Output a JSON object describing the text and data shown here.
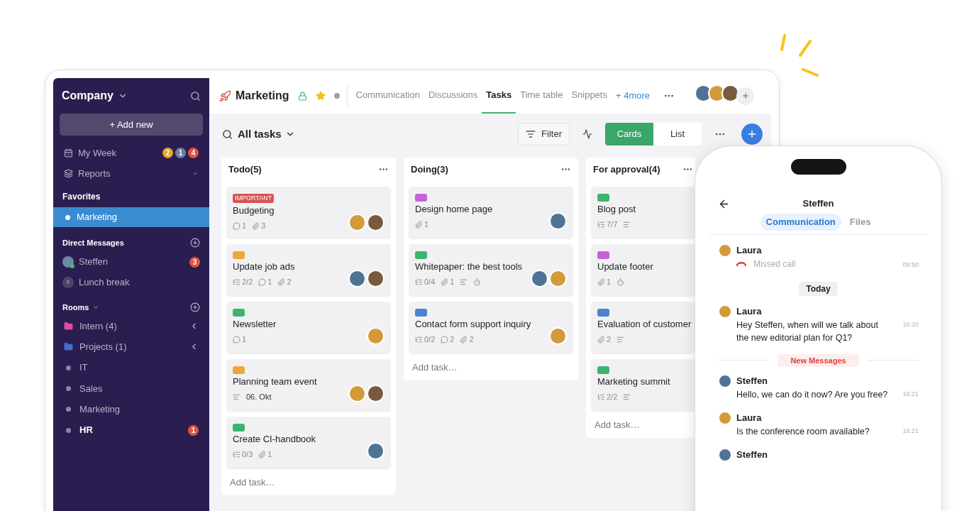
{
  "sidebar": {
    "title": "Company",
    "add_button": "+ Add new",
    "nav": [
      {
        "kind": "week",
        "label": "My Week",
        "badges": [
          {
            "text": "2",
            "color": "#e5a823"
          },
          {
            "text": "1",
            "color": "#6b7fa6"
          },
          {
            "text": "4",
            "color": "#e0533d"
          }
        ]
      },
      {
        "kind": "reports",
        "label": "Reports"
      }
    ],
    "favorites": {
      "heading": "Favorites",
      "items": [
        {
          "label": "Marketing",
          "selected": true
        }
      ]
    },
    "direct_messages": {
      "heading": "Direct Messages",
      "items": [
        {
          "kind": "person",
          "label": "Steffen",
          "online": true,
          "badge": "3"
        },
        {
          "kind": "group",
          "label": "Lunch break",
          "initial": "5"
        }
      ]
    },
    "rooms": {
      "heading": "Rooms",
      "items": [
        {
          "kind": "folder",
          "label": "Intern (4)",
          "color": "#e04fa0",
          "unread": false
        },
        {
          "kind": "folder",
          "label": "Projects (1)",
          "color": "#3f6fd0",
          "unread": false
        },
        {
          "kind": "room",
          "label": "IT",
          "unread": false
        },
        {
          "kind": "room",
          "label": "Sales",
          "unread": false
        },
        {
          "kind": "room",
          "label": "Marketing",
          "unread": false
        },
        {
          "kind": "room",
          "label": "HR",
          "unread": true,
          "badge": "1"
        }
      ]
    }
  },
  "header": {
    "title": "Marketing",
    "tabs": [
      {
        "label": "Communication",
        "selected": false
      },
      {
        "label": "Discussions",
        "selected": false
      },
      {
        "label": "Tasks",
        "selected": true
      },
      {
        "label": "Time table",
        "selected": false
      },
      {
        "label": "Snippets",
        "selected": false
      }
    ],
    "more_link": "+ 4more",
    "members": [
      {
        "color": "#4f7396"
      },
      {
        "color": "#d39a3a"
      },
      {
        "color": "#7a5a3c"
      }
    ]
  },
  "toolbar": {
    "view_title": "All tasks",
    "filter": "Filter",
    "views": [
      {
        "label": "Cards",
        "selected": true
      },
      {
        "label": "List",
        "selected": false
      }
    ]
  },
  "columns": [
    {
      "title": "Todo(5)",
      "add_task": "Add task…",
      "cards": [
        {
          "tag": {
            "kind": "badge",
            "text": "IMPORTANT"
          },
          "title": "Budgeting",
          "meta": [
            {
              "kind": "comments",
              "text": "1"
            },
            {
              "kind": "attachments",
              "text": "3"
            }
          ],
          "avatars": [
            {
              "color": "#d39a3a"
            },
            {
              "color": "#7a5a3c"
            }
          ]
        },
        {
          "tag": {
            "kind": "color",
            "color": "#eaa73c"
          },
          "title": "Update job ads",
          "meta": [
            {
              "kind": "subtasks",
              "text": "2/2"
            },
            {
              "kind": "comments",
              "text": "1"
            },
            {
              "kind": "attachments",
              "text": "2"
            }
          ],
          "avatars": [
            {
              "color": "#4f7396"
            },
            {
              "color": "#7a5a3c"
            }
          ]
        },
        {
          "tag": {
            "kind": "color",
            "color": "#3cb46e"
          },
          "title": "Newsletter",
          "meta": [
            {
              "kind": "comments",
              "text": "1"
            }
          ],
          "avatars": [
            {
              "color": "#d39a3a"
            }
          ]
        },
        {
          "tag": {
            "kind": "color",
            "color": "#eaa73c"
          },
          "title": "Planning team event",
          "meta": [
            {
              "kind": "notes",
              "text": "06. Okt"
            }
          ],
          "avatars": [
            {
              "color": "#d39a3a"
            },
            {
              "color": "#7a5a3c"
            }
          ]
        },
        {
          "tag": {
            "kind": "color",
            "color": "#3cb46e"
          },
          "title": "Create CI-handbook",
          "meta": [
            {
              "kind": "subtasks",
              "text": "0/3"
            },
            {
              "kind": "attachments",
              "text": "1"
            }
          ],
          "avatars": [
            {
              "color": "#4f7396"
            }
          ]
        }
      ]
    },
    {
      "title": "Doing(3)",
      "add_task": "Add task…",
      "cards": [
        {
          "tag": {
            "kind": "color",
            "color": "#c462d8"
          },
          "title": "Design home page",
          "meta": [
            {
              "kind": "attachments",
              "text": "1"
            }
          ],
          "avatars": [
            {
              "color": "#4f7396"
            }
          ]
        },
        {
          "tag": {
            "kind": "color",
            "color": "#3cb46e"
          },
          "title": "Whitepaper: the best tools",
          "meta": [
            {
              "kind": "subtasks",
              "text": "0/4"
            },
            {
              "kind": "attachments",
              "text": "1"
            },
            {
              "kind": "notes"
            },
            {
              "kind": "timer"
            }
          ],
          "avatars": [
            {
              "color": "#4f7396"
            },
            {
              "color": "#d39a3a"
            }
          ]
        },
        {
          "tag": {
            "kind": "color",
            "color": "#4a82d0"
          },
          "title": "Contact form support inquiry",
          "meta": [
            {
              "kind": "subtasks",
              "text": "0/2"
            },
            {
              "kind": "comments",
              "text": "2"
            },
            {
              "kind": "attachments",
              "text": "2"
            }
          ],
          "avatars": [
            {
              "color": "#d39a3a"
            }
          ]
        }
      ]
    },
    {
      "title": "For approval(4)",
      "add_task": "Add task…",
      "cards": [
        {
          "tag": {
            "kind": "color",
            "color": "#3cb46e"
          },
          "title": "Blog post",
          "meta": [
            {
              "kind": "subtasks",
              "text": "7/7"
            },
            {
              "kind": "notes"
            }
          ]
        },
        {
          "tag": {
            "kind": "color",
            "color": "#c462d8"
          },
          "title": "Update footer",
          "meta": [
            {
              "kind": "attachments",
              "text": "1"
            },
            {
              "kind": "timer"
            }
          ]
        },
        {
          "tag": {
            "kind": "color",
            "color": "#4a82d0"
          },
          "title": "Evaluation of customer",
          "meta": [
            {
              "kind": "attachments",
              "text": "2"
            },
            {
              "kind": "notes"
            }
          ]
        },
        {
          "tag": {
            "kind": "color",
            "color": "#3cb46e"
          },
          "title": "Marketing summit",
          "meta": [
            {
              "kind": "subtasks",
              "text": "2/2"
            },
            {
              "kind": "notes"
            }
          ]
        }
      ]
    }
  ],
  "phone": {
    "title": "Steffen",
    "tabs": [
      {
        "label": "Communication",
        "selected": true
      },
      {
        "label": "Files",
        "selected": false
      }
    ],
    "feed": [
      {
        "kind": "missed_call",
        "author": "Laura",
        "avatar": {
          "color": "#d39a3a"
        },
        "text": "Missed call",
        "time": "08:50"
      },
      {
        "kind": "date",
        "text": "Today"
      },
      {
        "kind": "message",
        "author": "Laura",
        "avatar": {
          "color": "#d39a3a"
        },
        "text": "Hey Steffen, when will we talk about the new editorial plan for Q1?",
        "time": "16:20"
      },
      {
        "kind": "new",
        "text": "New Messages"
      },
      {
        "kind": "message",
        "author": "Steffen",
        "avatar": {
          "color": "#4f7396"
        },
        "text": "Hello, we can do it now? Are you free?",
        "time": "16:21"
      },
      {
        "kind": "message",
        "author": "Laura",
        "avatar": {
          "color": "#d39a3a"
        },
        "text": "Is the conference room available?",
        "time": "16:21"
      },
      {
        "kind": "message",
        "author": "Steffen",
        "avatar": {
          "color": "#4f7396"
        }
      }
    ]
  }
}
